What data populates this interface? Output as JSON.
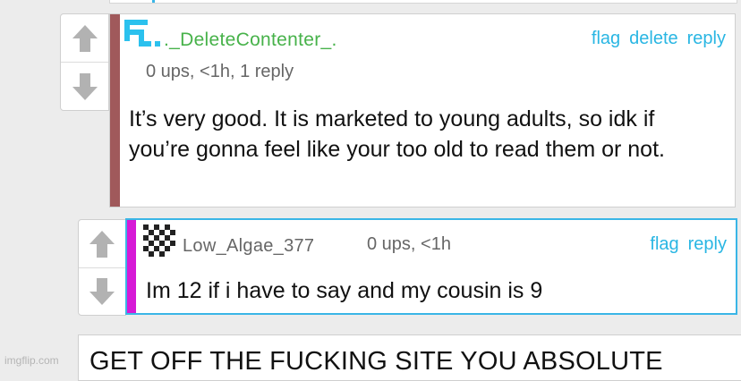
{
  "comment1": {
    "username": "._DeleteContenter_.",
    "meta": "0 ups, <1h, 1 reply",
    "body": "It’s very good. It is marketed to young adults, so idk if you’re gonna feel like your too old to read them or not.",
    "actions": {
      "flag": "flag",
      "delete": "delete",
      "reply": "reply"
    },
    "stripe_color": "#a0595b",
    "avatar_icon": "blue-blocky-avatar-icon"
  },
  "comment2": {
    "username": "Low_Algae_377",
    "meta": "0 ups, <1h",
    "body": "Im 12 if i have to say and my cousin is 9",
    "actions": {
      "flag": "flag",
      "reply": "reply"
    },
    "stripe_color": "#d61ad6",
    "avatar_icon": "checkered-avatar-icon"
  },
  "comment3": {
    "body": "GET OFF THE FUCKING SITE YOU ABSOLUTE"
  },
  "watermark": "imgflip.com",
  "colors": {
    "link": "#29b6e3",
    "username_green": "#47b24a",
    "reply_border": "#3ab5e6"
  }
}
